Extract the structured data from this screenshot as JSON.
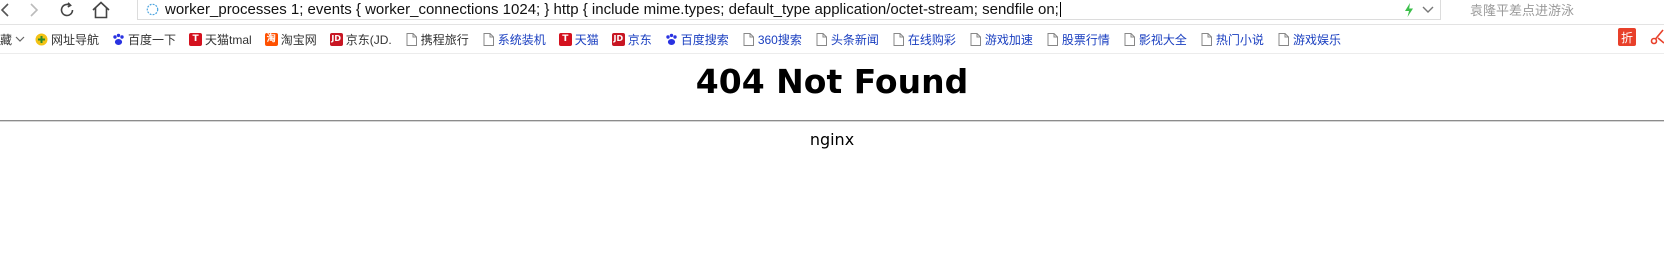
{
  "address_bar": {
    "url_text": "worker_processes 1; events { worker_connections 1024; } http { include mime.types; default_type application/octet-stream; sendfile on;"
  },
  "search": {
    "placeholder": "袁隆平差点进游泳"
  },
  "bookmarks": {
    "folder_label": "藏",
    "items": [
      {
        "label": "网址导航",
        "icon": "compass-icon"
      },
      {
        "label": "百度一下",
        "icon": "baidu-paw-icon"
      },
      {
        "label": "天猫tmal",
        "icon": "tmall-icon"
      },
      {
        "label": "淘宝网",
        "icon": "taobao-icon"
      },
      {
        "label": "京东(JD.",
        "icon": "jd-icon"
      },
      {
        "label": "携程旅行",
        "icon": "page-icon"
      },
      {
        "label": "系统装机",
        "icon": "page-icon"
      },
      {
        "label": "天猫",
        "icon": "tmall-icon"
      },
      {
        "label": "京东",
        "icon": "jd-icon"
      },
      {
        "label": "百度搜索",
        "icon": "baidu-paw-icon"
      },
      {
        "label": "360搜索",
        "icon": "page-icon"
      },
      {
        "label": "头条新闻",
        "icon": "page-icon"
      },
      {
        "label": "在线购彩",
        "icon": "page-icon"
      },
      {
        "label": "游戏加速",
        "icon": "page-icon"
      },
      {
        "label": "股票行情",
        "icon": "page-icon"
      },
      {
        "label": "影视大全",
        "icon": "page-icon"
      },
      {
        "label": "热门小说",
        "icon": "page-icon"
      },
      {
        "label": "游戏娱乐",
        "icon": "page-icon"
      }
    ]
  },
  "page": {
    "heading": "404 Not Found",
    "server_name": "nginx"
  },
  "colors": {
    "tmall_red": "#d4111e",
    "jd_red": "#c81623",
    "taobao_orange": "#ff5000",
    "baidu_blue": "#2932e1",
    "link_blue": "#1a3fc0"
  }
}
